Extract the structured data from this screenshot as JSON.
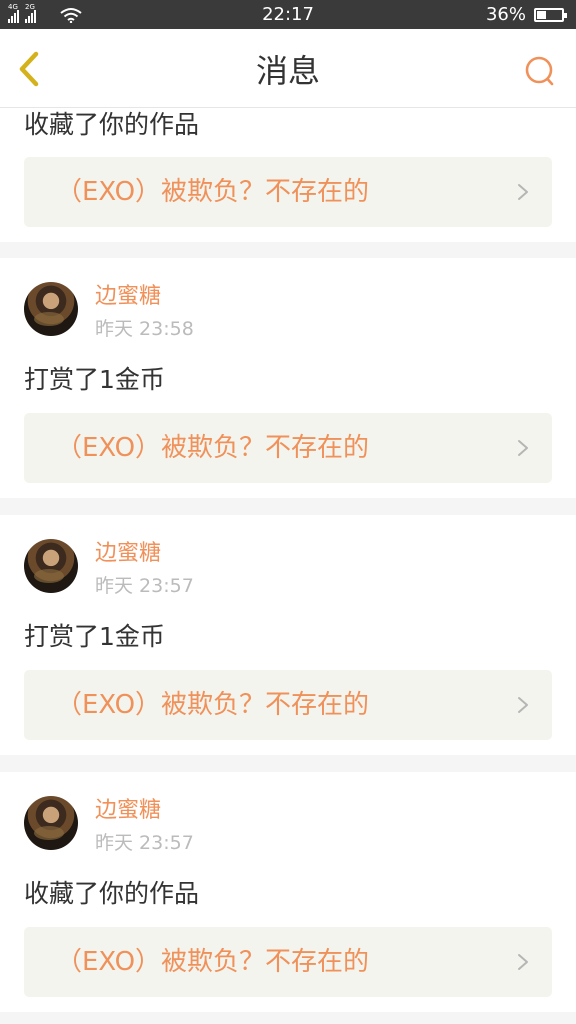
{
  "status_bar": {
    "signal_1_tag": "4G",
    "signal_2_tag": "2G",
    "time": "22:17",
    "battery_percent": "36%",
    "battery_level": 0.36,
    "icons": [
      "signal-icon",
      "signal-icon",
      "wifi-icon",
      "battery-icon"
    ]
  },
  "header": {
    "title": "消息",
    "back_icon": "chevron-left-icon",
    "search_icon": "search-icon",
    "accent_color": "#f0915a"
  },
  "messages": [
    {
      "action": "收藏了你的作品",
      "work_title": "（EXO）被欺负？不存在的"
    },
    {
      "user": "边蜜糖",
      "time": "昨天 23:58",
      "action": "打赏了1金币",
      "work_title": "（EXO）被欺负？不存在的"
    },
    {
      "user": "边蜜糖",
      "time": "昨天 23:57",
      "action": "打赏了1金币",
      "work_title": "（EXO）被欺负？不存在的"
    },
    {
      "user": "边蜜糖",
      "time": "昨天 23:57",
      "action": "收藏了你的作品",
      "work_title": "（EXO）被欺负？不存在的"
    }
  ]
}
